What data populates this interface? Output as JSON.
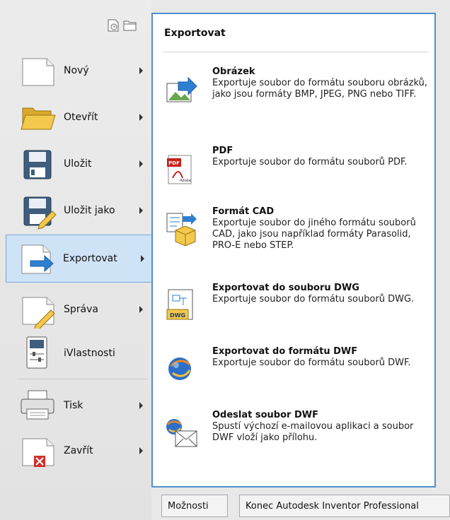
{
  "menu": {
    "items": [
      {
        "label": "Nový",
        "icon": "new-document-icon",
        "has_submenu": true
      },
      {
        "label": "Otevřít",
        "icon": "open-folder-icon",
        "has_submenu": true
      },
      {
        "label": "Uložit",
        "icon": "save-icon",
        "has_submenu": true
      },
      {
        "label": "Uložit jako",
        "icon": "save-as-icon",
        "has_submenu": true
      },
      {
        "label": "Exportovat",
        "icon": "export-icon",
        "has_submenu": true,
        "active": true
      },
      {
        "label": "Správa",
        "icon": "manage-icon",
        "has_submenu": true
      },
      {
        "label": "iVlastnosti",
        "icon": "iproperties-icon",
        "has_submenu": false
      },
      {
        "label": "Tisk",
        "icon": "print-icon",
        "has_submenu": true
      },
      {
        "label": "Zavřít",
        "icon": "close-document-icon",
        "has_submenu": true
      }
    ],
    "top_icons": [
      "recent-documents-icon",
      "open-documents-icon"
    ]
  },
  "panel": {
    "title": "Exportovat",
    "entries": [
      {
        "title": "Obrázek",
        "desc": "Exportuje soubor do formátu souboru obrázků, jako jsou formáty BMP, JPEG, PNG nebo TIFF.",
        "icon": "image-export-icon"
      },
      {
        "title": "PDF",
        "desc": "Exportuje soubor do formátu souborů PDF.",
        "icon": "pdf-icon"
      },
      {
        "title": "Formát CAD",
        "desc": "Exportuje soubor do jiného formátu souborů CAD, jako jsou například formáty Parasolid, PRO-E nebo STEP.",
        "icon": "cad-format-icon"
      },
      {
        "title": "Exportovat do souboru DWG",
        "desc": "Exportuje soubor do formátu souborů DWG.",
        "icon": "dwg-icon"
      },
      {
        "title": "Exportovat do formátu DWF",
        "desc": "Exportuje soubor do formátu souborů DWF.",
        "icon": "dwf-globe-icon"
      },
      {
        "title": "Odeslat soubor DWF",
        "desc": "Spustí výchozí e-mailovou aplikaci a soubor DWF vloží jako přílohu.",
        "icon": "send-dwf-icon"
      }
    ],
    "pdf_badge": "PDF",
    "pdf_sub": "Adobe",
    "dwg_badge": "DWG"
  },
  "buttons": {
    "options": "Možnosti",
    "exit": "Konec Autodesk Inventor Professional"
  },
  "colors": {
    "accent": "#4f8fd1",
    "active_bg": "#cfe3f7",
    "pdf_red": "#c8201c"
  }
}
